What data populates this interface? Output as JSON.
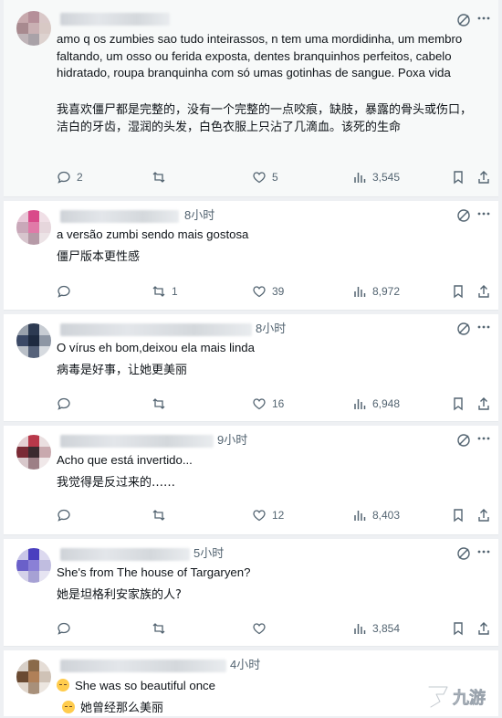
{
  "tweets": [
    {
      "time": "",
      "text": "amo q os zumbies sao tudo inteirassos, n tem uma mordidinha, um membro faltando, um osso ou ferida exposta, dentes branquinhos perfeitos, cabelo hidratado, roupa branquinha com só umas gotinhas de sangue. Poxa vida",
      "translation": "我喜欢僵尸都是完整的，没有一个完整的一点咬痕，缺肢，暴露的骨头或伤口，洁白的牙齿，湿润的头发，白色衣服上只沾了几滴血。该死的生命",
      "replies": "2",
      "retweets": "",
      "likes": "5",
      "views": "3,545"
    },
    {
      "time": "8小时",
      "text": "a versão zumbi sendo mais gostosa",
      "translation": "僵尸版本更性感",
      "replies": "",
      "retweets": "1",
      "likes": "39",
      "views": "8,972"
    },
    {
      "time": "8小时",
      "text": "O vírus eh bom,deixou ela mais linda",
      "translation": "病毒是好事，让她更美丽",
      "replies": "",
      "retweets": "",
      "likes": "16",
      "views": "6,948"
    },
    {
      "time": "9小时",
      "text": "Acho que está invertido...",
      "translation": "我觉得是反过来的……",
      "replies": "",
      "retweets": "",
      "likes": "12",
      "views": "8,403"
    },
    {
      "time": "5小时",
      "text": "She's from The house of Targaryen?",
      "translation": "她是坦格利安家族的人?",
      "replies": "",
      "retweets": "",
      "likes": "",
      "views": "3,854"
    },
    {
      "time": "4小时",
      "text": "She was so beautiful once",
      "translation": "她曾经那么美丽"
    }
  ],
  "icons": {
    "reply": "reply-icon",
    "retweet": "retweet-icon",
    "like": "like-icon",
    "views": "views-icon",
    "bookmark": "bookmark-icon",
    "share": "share-icon",
    "translate": "translate-icon",
    "emoji": "pensive-face-emoji"
  },
  "watermark": "九游",
  "colors": {
    "text": "#0f1419",
    "muted": "#536471",
    "page": "#eef0f3"
  }
}
